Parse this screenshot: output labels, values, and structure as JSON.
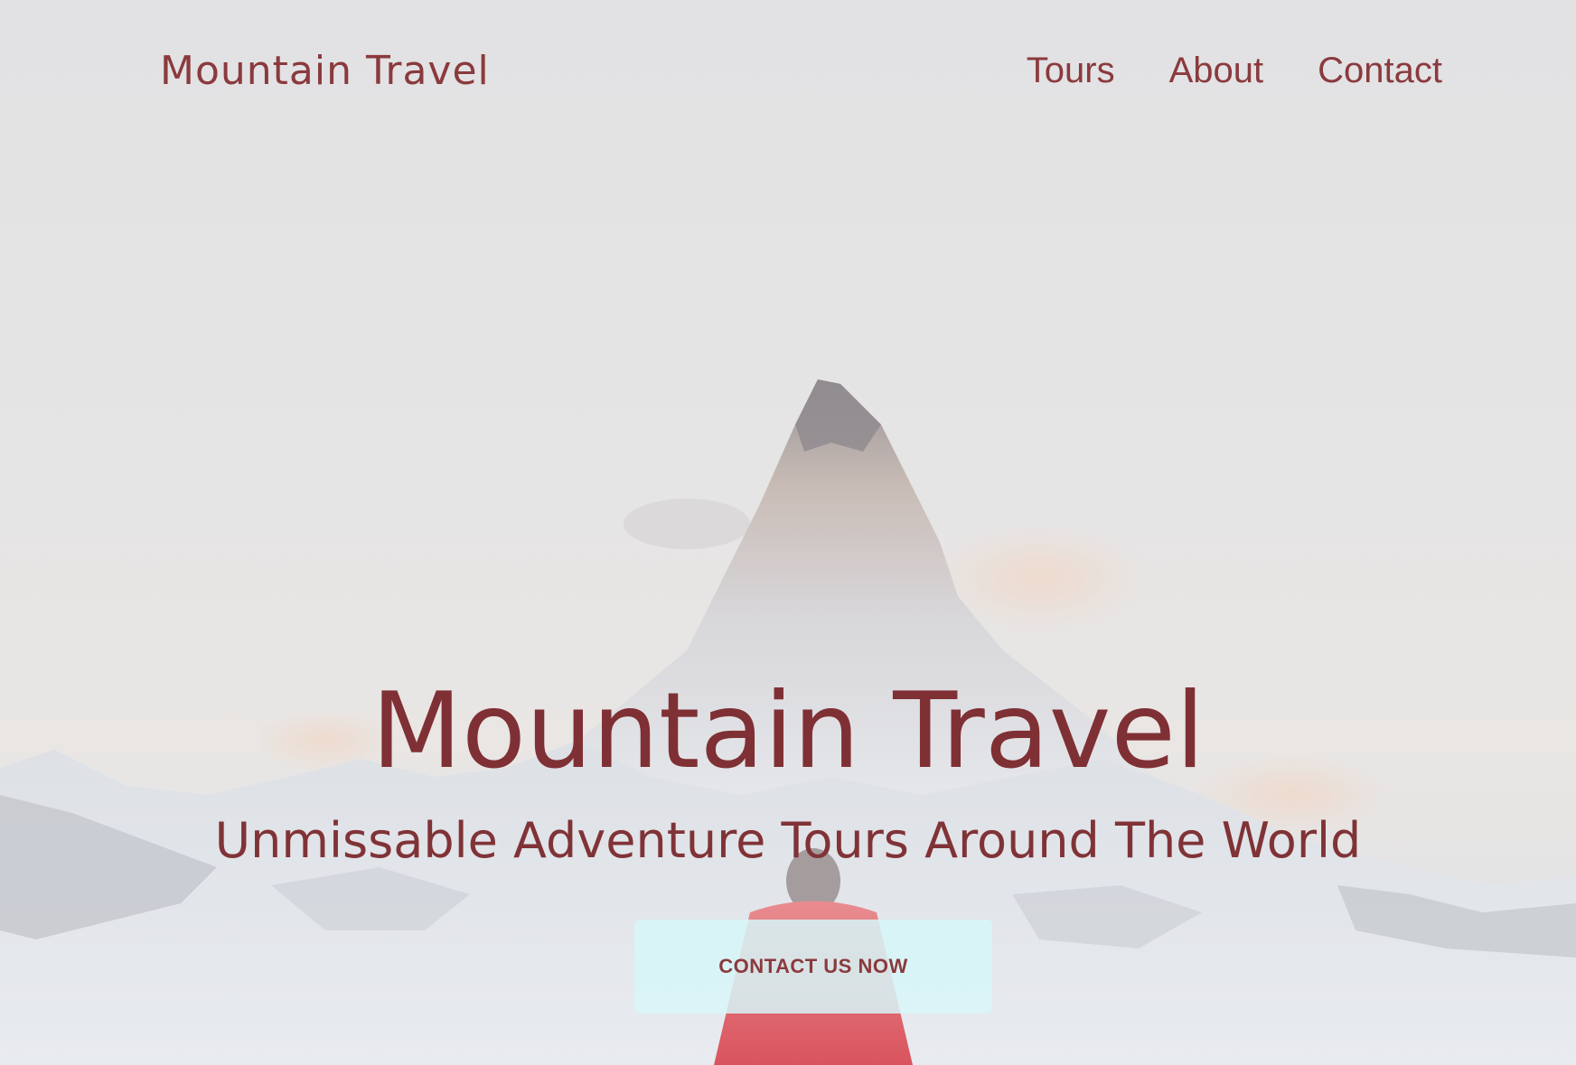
{
  "nav": {
    "brand": "Mountain Travel",
    "links": [
      "Tours",
      "About",
      "Contact"
    ]
  },
  "hero": {
    "title": "Mountain Travel",
    "subtitle": "Unmissable Adventure Tours Around The World",
    "cta_label": "CONTACT US NOW",
    "background": "snowy-mountain-peak-with-hiker-in-red-jacket"
  },
  "colors": {
    "brand_text": "#8a3a3d",
    "hero_title": "#7f3034",
    "cta_background": "#d7f6f8",
    "page_background": "#e4e4e6"
  }
}
